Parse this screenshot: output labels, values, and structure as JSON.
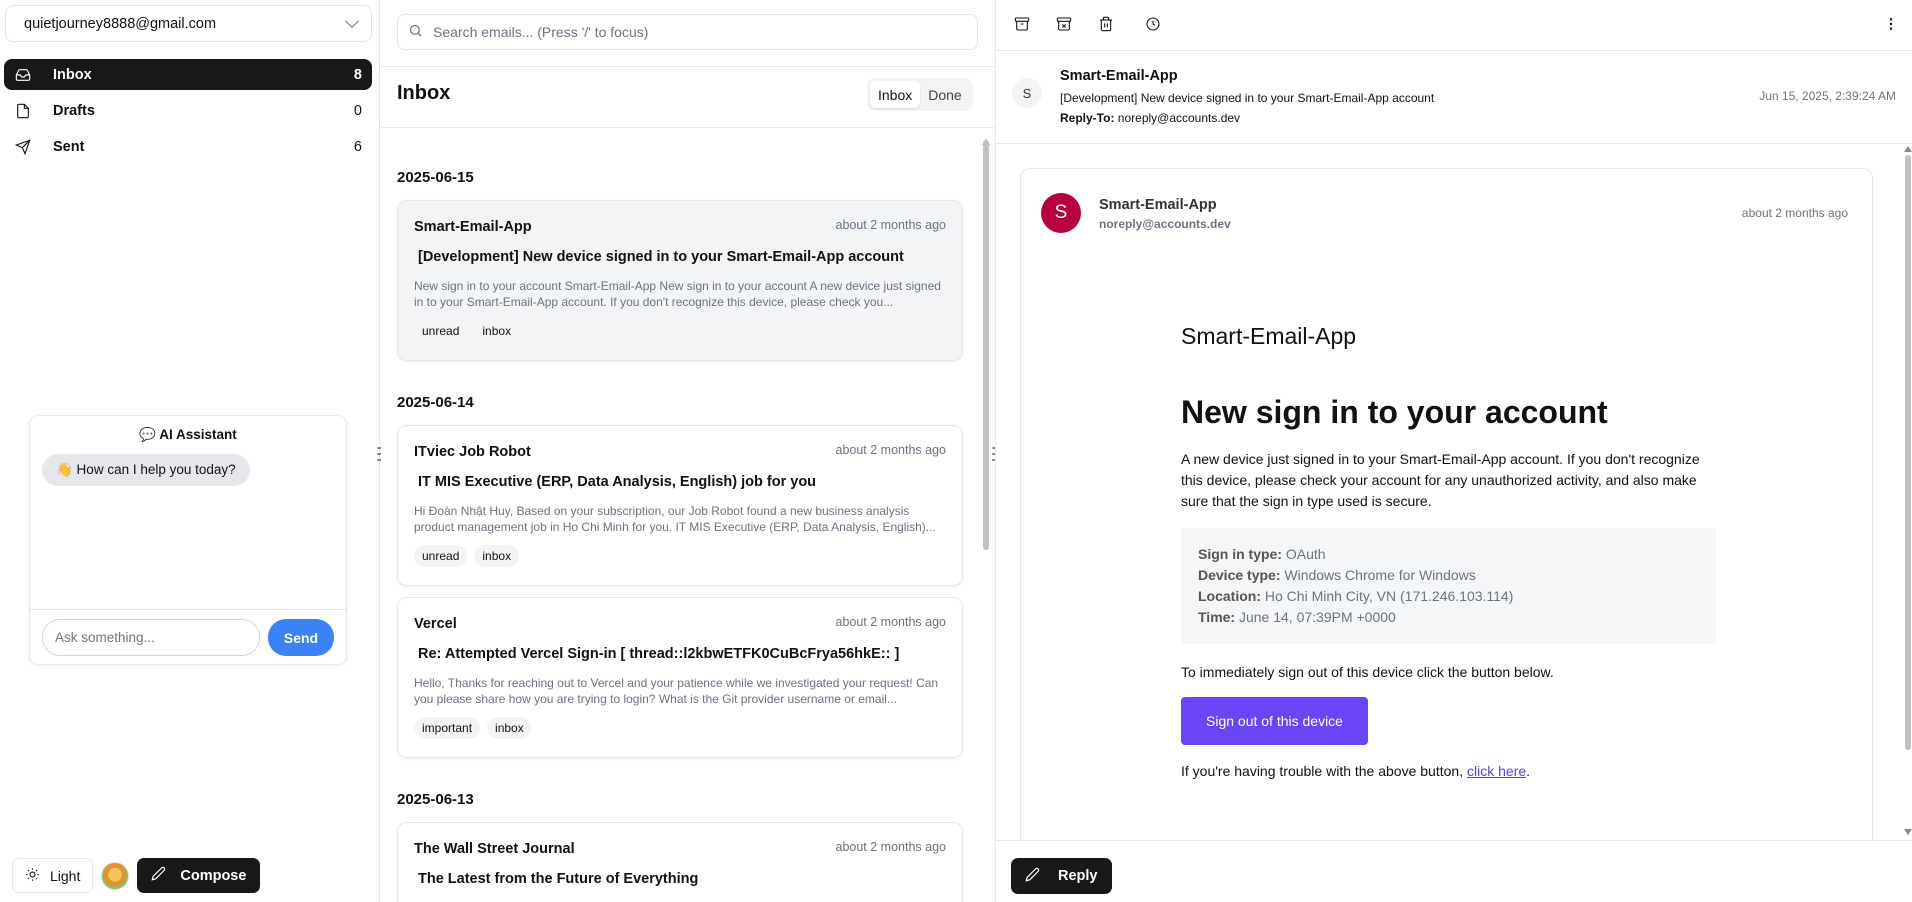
{
  "account": {
    "email": "quietjourney8888@gmail.com"
  },
  "nav": [
    {
      "label": "Inbox",
      "count": "8",
      "icon": "inbox-icon"
    },
    {
      "label": "Drafts",
      "count": "0",
      "icon": "file-icon"
    },
    {
      "label": "Sent",
      "count": "6",
      "icon": "send-icon"
    }
  ],
  "assistant": {
    "title": "💬 AI Assistant",
    "greeting": "👋 How can I help you today?",
    "input_placeholder": "Ask something...",
    "send_label": "Send"
  },
  "footer": {
    "theme_label": "Light",
    "compose_label": "Compose"
  },
  "search": {
    "placeholder": "Search emails... (Press '/' to focus)"
  },
  "list": {
    "title": "Inbox",
    "tabs": [
      "Inbox",
      "Done"
    ],
    "active_tab": "Inbox",
    "groups": [
      {
        "date": "2025-06-15",
        "emails": [
          {
            "from": "Smart-Email-App",
            "when": "about 2 months ago",
            "subject": "[Development] New device signed in to your Smart-Email-App account",
            "snippet": "New sign in to your account Smart-Email-App New sign in to your account A new device just signed in to your Smart-Email-App account. If you don't recognize this device, please check you...",
            "tags": [
              "unread",
              "inbox"
            ],
            "selected": true
          }
        ]
      },
      {
        "date": "2025-06-14",
        "emails": [
          {
            "from": "ITviec Job Robot",
            "when": "about 2 months ago",
            "subject": "IT MIS Executive (ERP, Data Analysis, English) job for you",
            "snippet": "Hi Đoàn Nhật Huy, Based on your subscription, our Job Robot found a new business analysis product management job in Ho Chi Minh for you. IT MIS Executive (ERP, Data Analysis, English)...",
            "tags": [
              "unread",
              "inbox"
            ]
          },
          {
            "from": "Vercel",
            "when": "about 2 months ago",
            "subject": "Re: Attempted Vercel Sign-in [ thread::l2kbwETFK0CuBcFrya56hkE:: ]",
            "snippet": "Hello, Thanks for reaching out to Vercel and your patience while we investigated your request! Can you please share how you are trying to login? What is the Git provider username or email...",
            "tags": [
              "important",
              "inbox"
            ]
          }
        ]
      },
      {
        "date": "2025-06-13",
        "emails": [
          {
            "from": "The Wall Street Journal",
            "when": "about 2 months ago",
            "subject": "The Latest from the Future of Everything",
            "snippet": "",
            "tags": []
          }
        ]
      }
    ]
  },
  "reader": {
    "header": {
      "avatar_letter": "S",
      "from": "Smart-Email-App",
      "subject": "[Development] New device signed in to your Smart-Email-App account",
      "reply_to_label": "Reply-To:",
      "reply_to": "noreply@accounts.dev",
      "date": "Jun 15, 2025, 2:39:24 AM"
    },
    "message": {
      "avatar_letter": "S",
      "avatar_color": "#b9003e",
      "from": "Smart-Email-App",
      "address": "noreply@accounts.dev",
      "when": "about 2 months ago",
      "brand": "Smart-Email-App",
      "heading": "New sign in to your account",
      "intro": "A new device just signed in to your Smart-Email-App account. If you don't recognize this device, please check your account for any unauthorized activity, and also make sure that the sign in type used is secure.",
      "details": [
        {
          "label": "Sign in type:",
          "value": "OAuth"
        },
        {
          "label": "Device type:",
          "value": "Windows Chrome for Windows"
        },
        {
          "label": "Location:",
          "value": "Ho Chi Minh City, VN (171.246.103.114)"
        },
        {
          "label": "Time:",
          "value": "June 14, 07:39PM +0000"
        }
      ],
      "instruction": "To immediately sign out of this device click the button below.",
      "button_label": "Sign out of this device",
      "button_color": "#6a45f5",
      "trouble_text": "If you're having trouble with the above button,",
      "trouble_link": "click here",
      "trouble_end": "."
    },
    "reply_label": "Reply"
  }
}
